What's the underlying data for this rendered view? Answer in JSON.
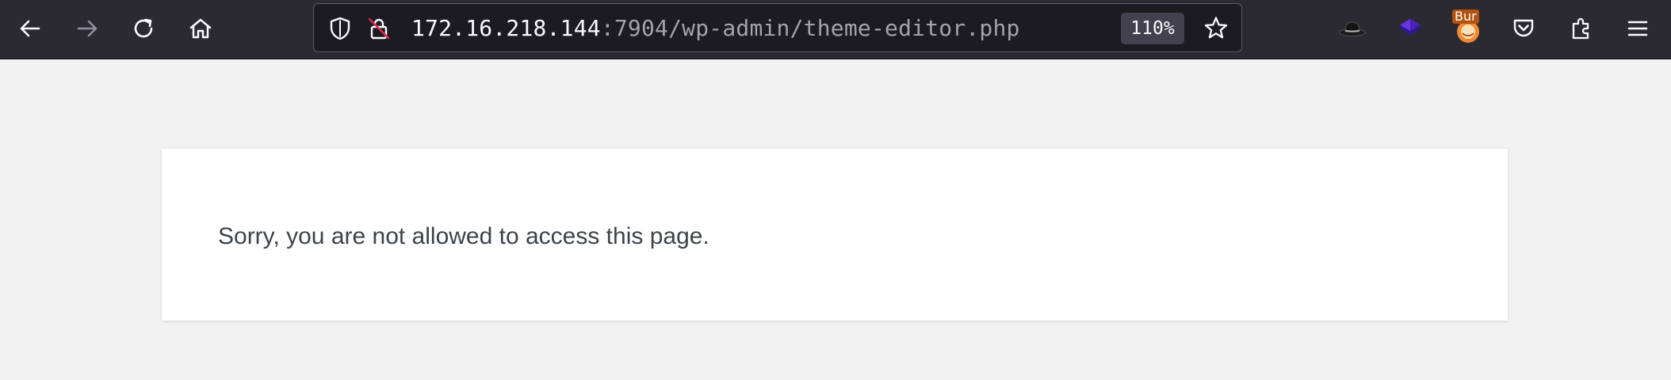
{
  "browser": {
    "url": {
      "host": "172.16.218.144",
      "path": ":7904/wp-admin/theme-editor.php"
    },
    "zoom_level": "110%",
    "nav_icons": [
      "back-arrow-icon",
      "forward-arrow-icon",
      "reload-icon",
      "home-icon"
    ],
    "url_icons": [
      "tracking-shield-icon",
      "insecure-lock-icon"
    ],
    "extension_icons": [
      "hat-extension-icon",
      "stack-extension-icon",
      "burp-extension-icon",
      "pocket-icon",
      "extensions-puzzle-icon",
      "hamburger-menu-icon"
    ],
    "burp_badge_label": "Bur"
  },
  "page": {
    "message": "Sorry, you are not allowed to access this page."
  },
  "colors": {
    "toolbar_bg": "#2b2a33",
    "urlbar_bg": "#1c1b22",
    "page_bg": "#f1f1f1",
    "card_bg": "#ffffff",
    "message_text": "#3c434a"
  }
}
